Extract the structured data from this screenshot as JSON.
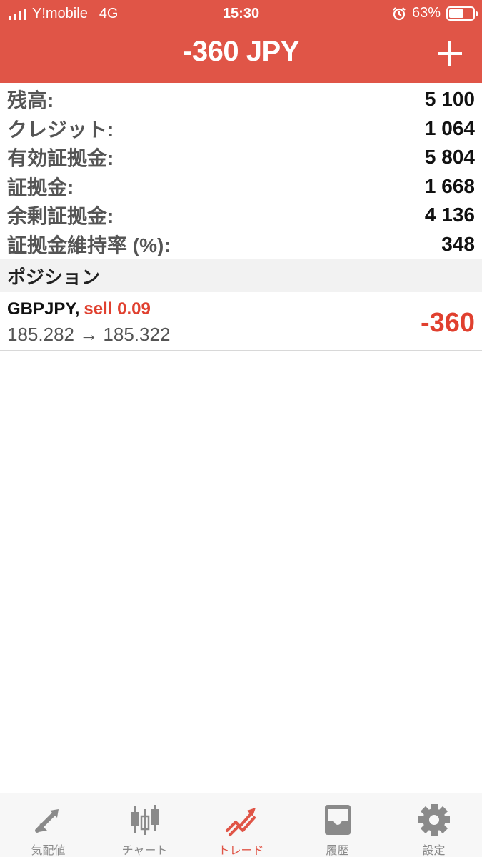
{
  "status_bar": {
    "carrier": "Y!mobile",
    "network": "4G",
    "time": "15:30",
    "battery": "63%",
    "battery_level": 0.63
  },
  "header": {
    "title": "-360 JPY"
  },
  "summary": [
    {
      "label": "残高:",
      "value": "5 100"
    },
    {
      "label": "クレジット:",
      "value": "1 064"
    },
    {
      "label": "有効証拠金:",
      "value": "5 804"
    },
    {
      "label": "証拠金:",
      "value": "1 668"
    },
    {
      "label": "余剰証拠金:",
      "value": "4 136"
    },
    {
      "label": "証拠金維持率 (%):",
      "value": "348"
    }
  ],
  "positions_section": {
    "title": "ポジション"
  },
  "positions": [
    {
      "symbol": "GBPJPY,",
      "side": "sell 0.09",
      "prices": "185.282 → 185.322",
      "profit": "-360"
    }
  ],
  "tabs": [
    {
      "label": "気配値",
      "icon": "quotes-icon",
      "active": false
    },
    {
      "label": "チャート",
      "icon": "chart-icon",
      "active": false
    },
    {
      "label": "トレード",
      "icon": "trade-icon",
      "active": true
    },
    {
      "label": "履歴",
      "icon": "history-icon",
      "active": false
    },
    {
      "label": "設定",
      "icon": "settings-icon",
      "active": false
    }
  ],
  "colors": {
    "header_bg": "#e05547",
    "negative": "#e0402f",
    "tab_active": "#e05547",
    "tab_inactive": "#8a8a8a"
  }
}
